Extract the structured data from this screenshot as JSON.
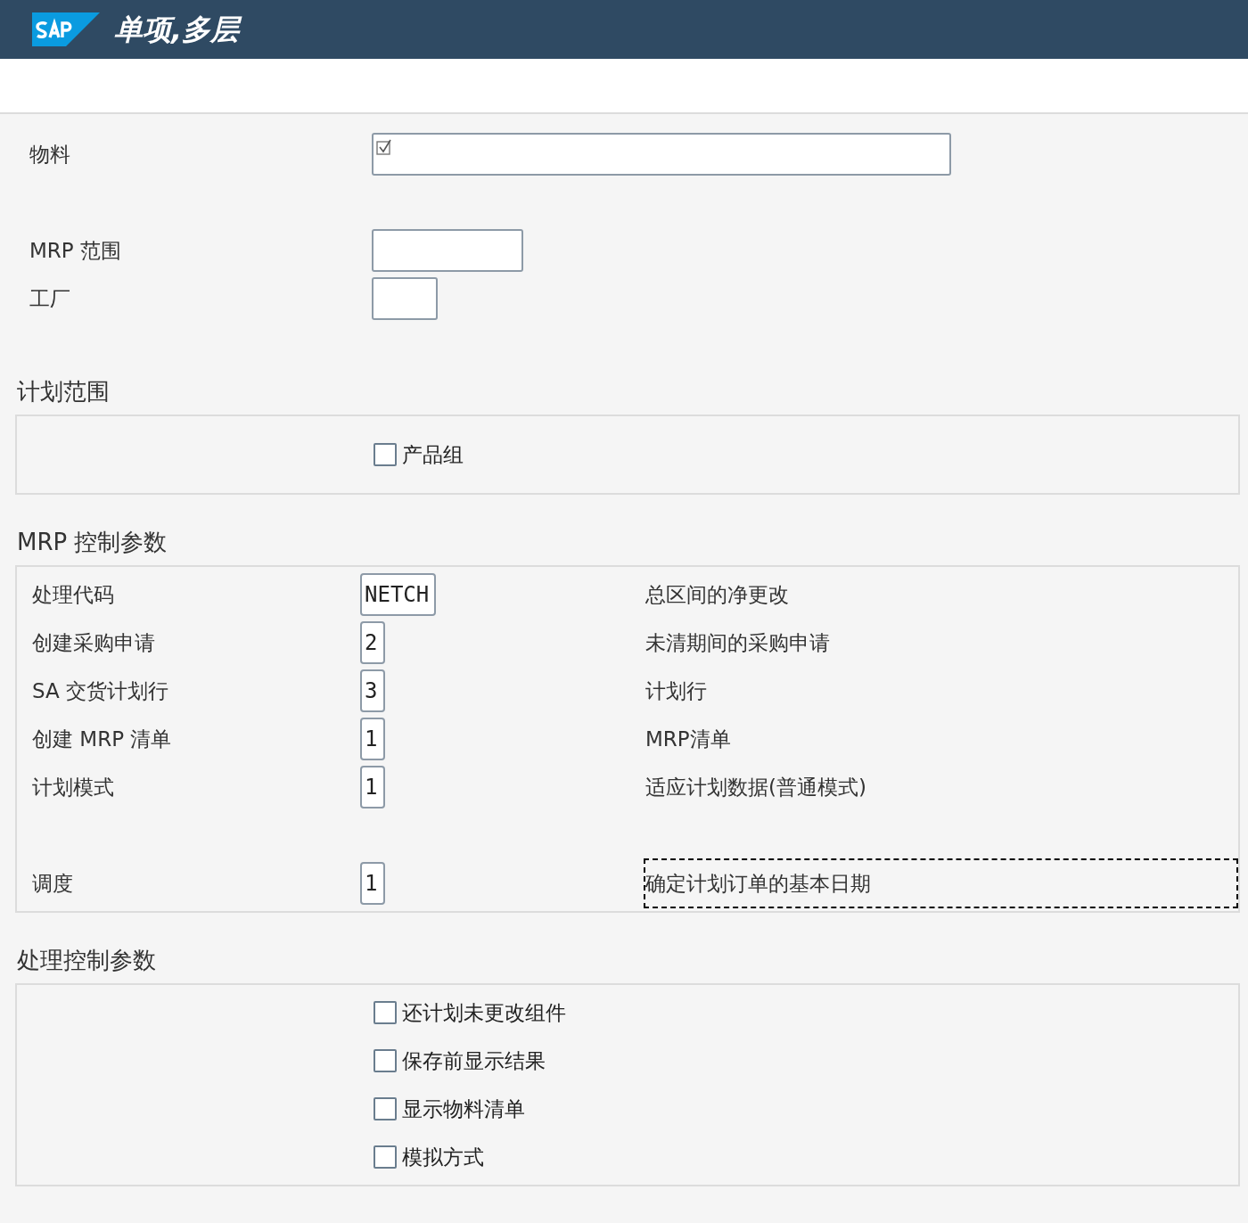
{
  "header": {
    "title": "单项,多层"
  },
  "selection": [
    {
      "label": "物料",
      "kind": "long",
      "required": true
    },
    {
      "label": "MRP 范围",
      "kind": "medium",
      "required": false
    },
    {
      "label": "工厂",
      "kind": "short",
      "required": false
    }
  ],
  "planning_scope": {
    "title": "计划范围",
    "options": [
      {
        "label": "产品组",
        "checked": false
      }
    ]
  },
  "mrp_control": {
    "title": "MRP 控制参数",
    "rows": [
      {
        "label": "处理代码",
        "value": "NETCH",
        "description": "总区间的净更改",
        "focused": false
      },
      {
        "label": "创建采购申请",
        "value": "2",
        "description": "未清期间的采购申请",
        "focused": false
      },
      {
        "label": "SA 交货计划行",
        "value": "3",
        "description": "计划行",
        "focused": false
      },
      {
        "label": "创建 MRP 清单",
        "value": "1",
        "description": "MRP清单",
        "focused": false
      },
      {
        "label": "计划模式",
        "value": "1",
        "description": "适应计划数据(普通模式)",
        "focused": false
      }
    ],
    "rows_2": [
      {
        "label": "调度",
        "value": "1",
        "description": "确定计划订单的基本日期",
        "focused": true
      }
    ]
  },
  "process_control": {
    "title": "处理控制参数",
    "options": [
      {
        "label": "还计划未更改组件",
        "checked": false
      },
      {
        "label": "保存前显示结果",
        "checked": false
      },
      {
        "label": "显示物料清单",
        "checked": false
      },
      {
        "label": "模拟方式",
        "checked": false
      }
    ]
  }
}
